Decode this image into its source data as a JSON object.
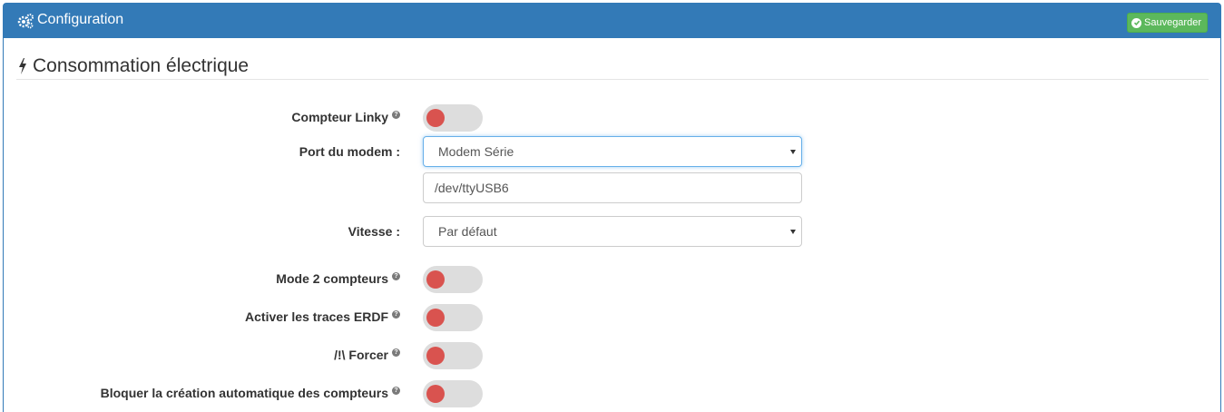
{
  "header": {
    "title": "Configuration",
    "save_label": "Sauvegarder",
    "icon": "gears-icon",
    "color": "#337ab7"
  },
  "section": {
    "title": "Consommation électrique",
    "icon": "bolt-icon"
  },
  "fields": {
    "linky": {
      "label": "Compteur Linky",
      "value": "off"
    },
    "modem_port": {
      "label": "Port du modem :",
      "selected": "Modem Série"
    },
    "device_path": {
      "value": "/dev/ttyUSB6"
    },
    "speed": {
      "label": "Vitesse :",
      "selected": "Par défaut"
    },
    "two_meters": {
      "label": "Mode 2 compteurs",
      "value": "off"
    },
    "erdf_traces": {
      "label": "Activer les traces ERDF",
      "value": "off"
    },
    "force": {
      "label": "/!\\ Forcer",
      "value": "off"
    },
    "block_auto": {
      "label": "Bloquer la création automatique des compteurs",
      "value": "off"
    }
  },
  "colors": {
    "toggle_off_knob": "#d9534f",
    "save_button": "#5cb85c"
  }
}
